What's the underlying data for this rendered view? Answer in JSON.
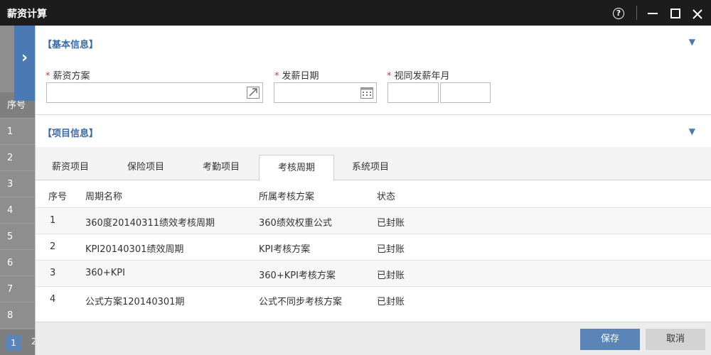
{
  "window": {
    "title": "薪资计算",
    "help_icon": "question-circle-icon",
    "minimize_icon": "minimize-icon",
    "maximize_icon": "maximize-icon",
    "close_icon": "close-icon"
  },
  "background": {
    "list_header": "序号",
    "rows": [
      "1",
      "2",
      "3",
      "4",
      "5",
      "6",
      "7",
      "8"
    ],
    "pager": {
      "current": "1",
      "next": "2"
    }
  },
  "side_toggle": {
    "glyph": "›"
  },
  "basic_info": {
    "title": "【基本信息】",
    "collapse_glyph": "▼",
    "fields": {
      "salary_plan": {
        "label": "薪资方案",
        "required": "*",
        "value": ""
      },
      "pay_date": {
        "label": "发薪日期",
        "required": "*",
        "value": ""
      },
      "as_pay_month": {
        "label": "视同发薪年月",
        "required": "*",
        "year": "",
        "month": ""
      }
    }
  },
  "project_info": {
    "title": "【项目信息】",
    "collapse_glyph": "▼"
  },
  "tabs": [
    {
      "label": "薪资项目",
      "active": false
    },
    {
      "label": "保险项目",
      "active": false
    },
    {
      "label": "考勤项目",
      "active": false
    },
    {
      "label": "考核周期",
      "active": true
    },
    {
      "label": "系统项目",
      "active": false
    }
  ],
  "table": {
    "columns": [
      "序号",
      "周期名称",
      "所属考核方案",
      "状态"
    ],
    "rows": [
      {
        "no": "1",
        "name": "360度20140311绩效考核周期",
        "plan": "360绩效权重公式",
        "status": "已封账"
      },
      {
        "no": "2",
        "name": "KPI20140301绩效周期",
        "plan": "KPI考核方案",
        "status": "已封账"
      },
      {
        "no": "3",
        "name": "360+KPI",
        "plan": "360+KPI考核方案",
        "status": "已封账"
      },
      {
        "no": "4",
        "name": "公式方案120140301期",
        "plan": "公式不同步考核方案",
        "status": "已封账"
      }
    ]
  },
  "footer": {
    "save_label": "保存",
    "cancel_label": "取消"
  },
  "colors": {
    "accent": "#5b84b7",
    "title_bar": "#1c1c1c",
    "section_title": "#3a6aa4"
  }
}
